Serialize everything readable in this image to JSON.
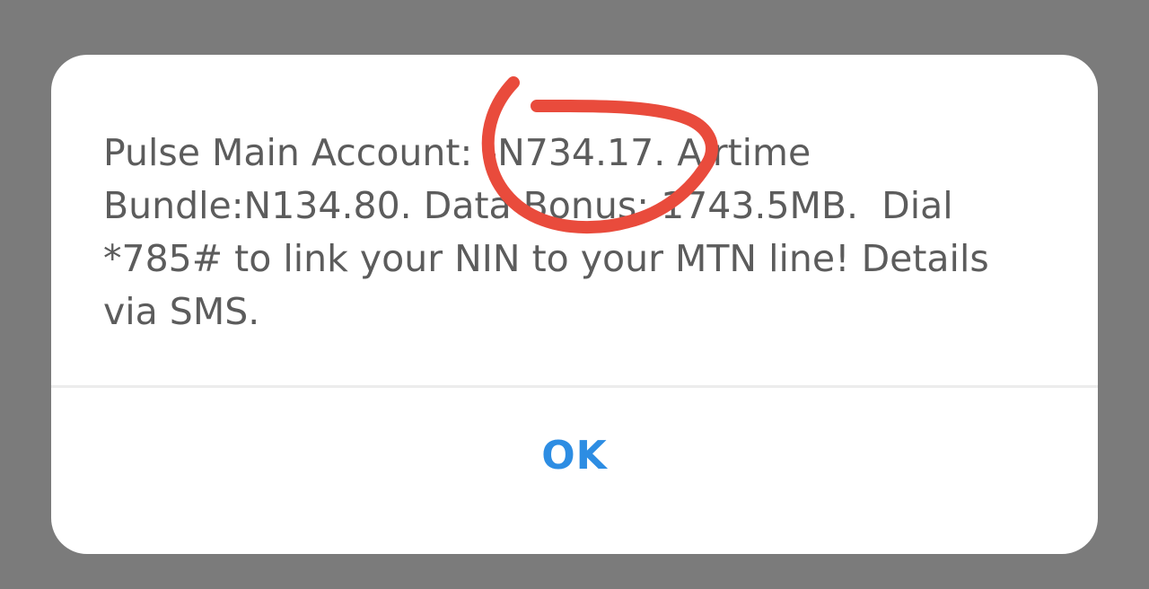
{
  "dialog": {
    "message": "Pulse Main Account: -N734.17. Airtime\nBundle:N134.80. Data Bonus: 1743.5MB.  Dial\n*785# to link your NIN to your MTN line! Details\nvia SMS.",
    "ok_label": "OK"
  },
  "colors": {
    "backdrop": "#7b7b7b",
    "dialog_background": "#ffffff",
    "message_text": "#5c5c5c",
    "button_text": "#2d8de3",
    "annotation_stroke": "#e94b3c"
  }
}
